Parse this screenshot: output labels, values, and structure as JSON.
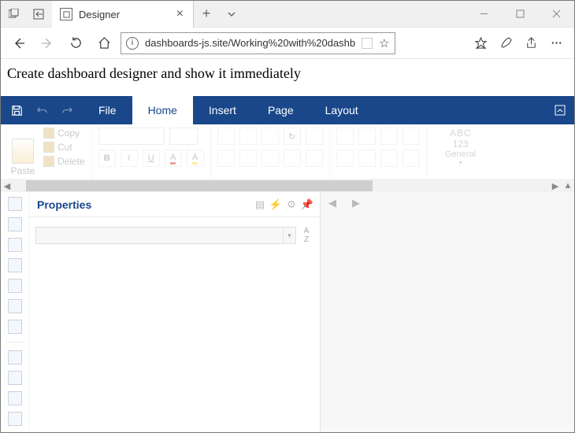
{
  "browser": {
    "tab_title": "Designer",
    "url_display": "dashboards-js.site/Working%20with%20dashb"
  },
  "page": {
    "heading": "Create dashboard designer and show it immediately"
  },
  "ribbon": {
    "tabs": {
      "file": "File",
      "home": "Home",
      "insert": "Insert",
      "page": "Page",
      "layout": "Layout"
    },
    "clipboard": {
      "paste": "Paste",
      "copy": "Copy",
      "cut": "Cut",
      "delete": "Delete"
    },
    "font_buttons": {
      "b": "B",
      "i": "I",
      "u": "U"
    },
    "number": {
      "abc": "ABC",
      "n123": "123",
      "general": "General"
    }
  },
  "panels": {
    "properties_title": "Properties"
  }
}
